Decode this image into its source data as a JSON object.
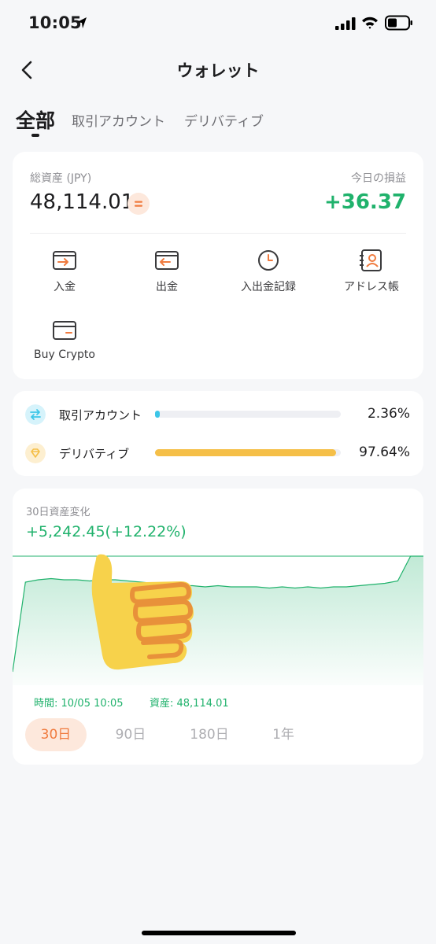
{
  "status_bar": {
    "time": "10:05"
  },
  "nav": {
    "title": "ウォレット"
  },
  "tabs": [
    {
      "label": "全部",
      "active": true
    },
    {
      "label": "取引アカウント",
      "active": false
    },
    {
      "label": "デリバティブ",
      "active": false
    }
  ],
  "assets": {
    "total_label": "総資産 (JPY)",
    "total_value": "48,114.01",
    "pnl_label": "今日の損益",
    "pnl_value": "+36.37",
    "actions": [
      {
        "label": "入金",
        "icon": "deposit-icon"
      },
      {
        "label": "出金",
        "icon": "withdraw-icon"
      },
      {
        "label": "入出金記録",
        "icon": "clock-icon"
      },
      {
        "label": "アドレス帳",
        "icon": "address-book-icon"
      },
      {
        "label": "Buy Crypto",
        "icon": "card-icon"
      }
    ]
  },
  "allocation": [
    {
      "name": "取引アカウント",
      "percent": "2.36%",
      "fraction": 0.0236,
      "color": "#3cc6e8",
      "icon": "transfer-icon"
    },
    {
      "name": "デリバティブ",
      "percent": "97.64%",
      "fraction": 0.9764,
      "color": "#f5bf48",
      "icon": "diamond-icon"
    }
  ],
  "chart": {
    "title": "30日資産変化",
    "change": "+5,242.45(+12.22%)",
    "time_label": "時間: 10/05 10:05",
    "asset_label": "資産: 48,114.01",
    "ranges": [
      "30日",
      "90日",
      "180日",
      "1年"
    ],
    "selected_range": "30日",
    "line_color": "#20b26c"
  },
  "chart_data": {
    "type": "area",
    "title": "30日資産変化",
    "xlabel": "",
    "ylabel": "",
    "y": [
      2,
      78,
      80,
      81,
      80,
      80,
      79,
      80,
      80,
      79,
      78,
      77,
      76,
      75,
      75,
      74,
      75,
      74,
      74,
      74,
      73,
      74,
      73,
      74,
      73,
      74,
      74,
      75,
      76,
      77,
      79,
      100,
      100
    ]
  }
}
